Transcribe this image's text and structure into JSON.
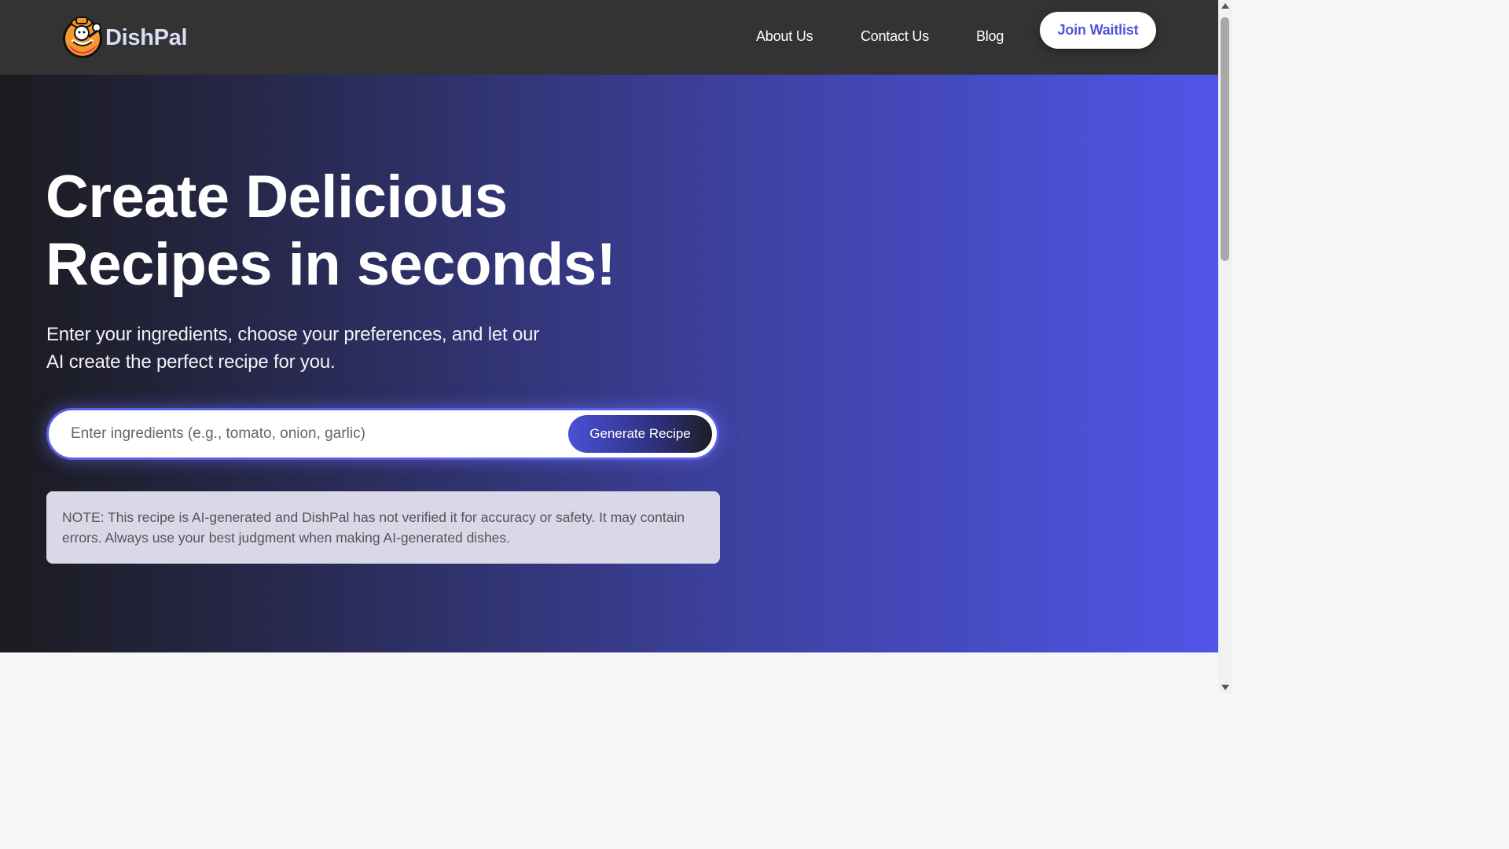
{
  "brand": {
    "name": "DishPal",
    "logo_icon": "chef-mascot-icon"
  },
  "nav": {
    "links": [
      "About Us",
      "Contact Us",
      "Blog"
    ],
    "cta": "Join Waitlist"
  },
  "hero": {
    "title_line1": "Create Delicious",
    "title_line2": "Recipes in seconds!",
    "subtitle_line1": "Enter your ingredients, choose your preferences, and let our",
    "subtitle_line2": "AI create the perfect recipe for you.",
    "search": {
      "placeholder": "Enter ingredients (e.g., tomato, onion, garlic)",
      "value": "",
      "button": "Generate Recipe"
    },
    "note": "NOTE: This recipe is AI-generated and DishPal has not verified it for accuracy or safety. It may contain errors. Always use your best judgment when making AI-generated dishes."
  },
  "colors": {
    "navbar": "#333333",
    "accent": "#4f55d9",
    "hero_gradient_start": "#1b1b1f",
    "hero_gradient_end": "#5055e8"
  }
}
